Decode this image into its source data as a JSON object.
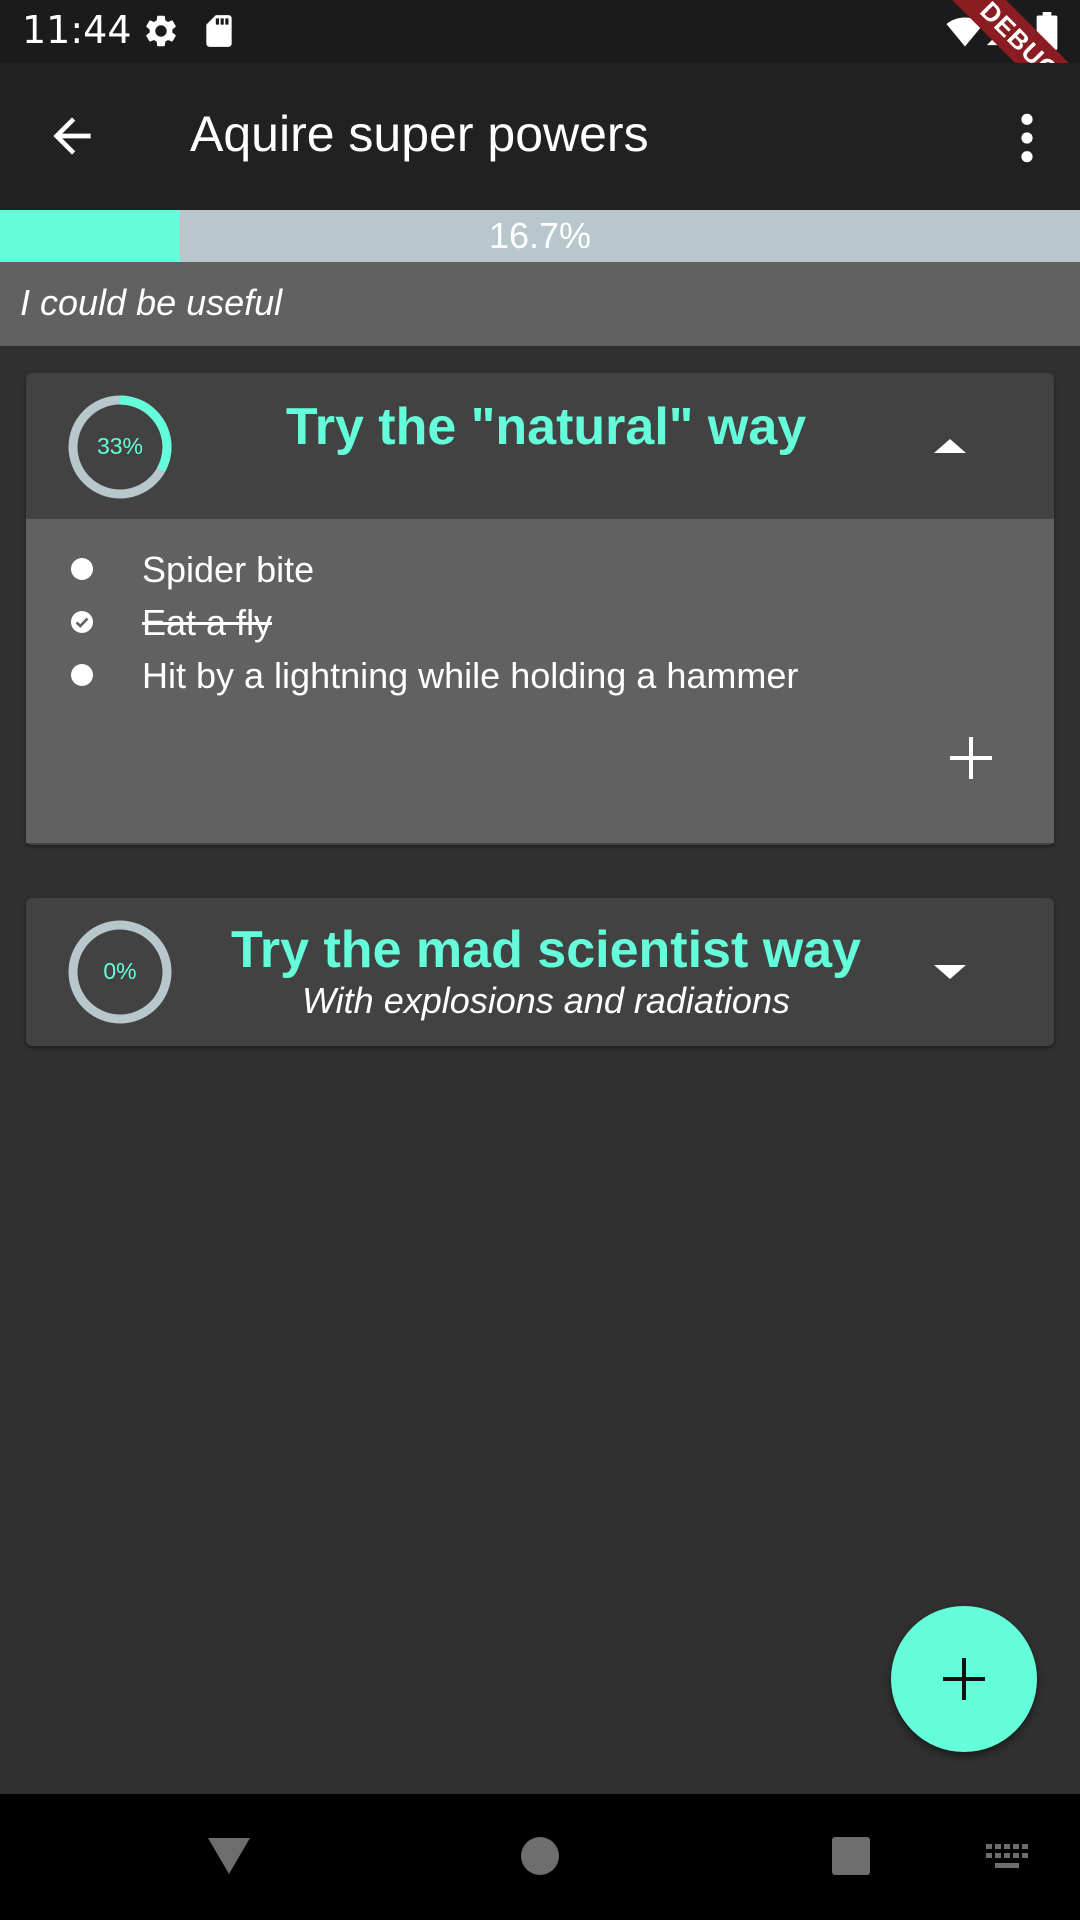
{
  "status_bar": {
    "time": "11:44",
    "icons": [
      "settings-icon",
      "sd-card-icon",
      "wifi-icon",
      "signal-icon",
      "battery-icon"
    ],
    "debug_banner": "DEBUG"
  },
  "app_bar": {
    "title": "Aquire super powers",
    "back_icon": "arrow-back-icon",
    "menu_icon": "more-vert-icon"
  },
  "goal": {
    "progress": 0.167,
    "progress_label": "16.7%",
    "description": "I could be useful"
  },
  "ways": [
    {
      "title": "Try the \"natural\" way",
      "subtitle": "",
      "progress": 0.33,
      "progress_label": "33%",
      "expanded": true,
      "steps": [
        {
          "label": "Spider bite",
          "done": false
        },
        {
          "label": "Eat a fly",
          "done": true
        },
        {
          "label": "Hit by a lightning while holding a hammer",
          "done": false
        }
      ],
      "add_step_icon": "plus-icon"
    },
    {
      "title": "Try the mad scientist way",
      "subtitle": "With explosions and radiations",
      "progress": 0.0,
      "progress_label": "0%",
      "expanded": false
    }
  ],
  "fab_icon": "plus-icon",
  "nav_bar": {
    "icons": [
      "back-triangle-icon",
      "home-circle-icon",
      "recents-square-icon",
      "keyboard-icon"
    ]
  },
  "colors": {
    "accent": "#64ffda",
    "background": "#303030",
    "app_bar": "#212121",
    "card": "#424242",
    "card_body": "#616161",
    "progress_track": "#b8c7cc",
    "debug_ribbon": "#8b1c22"
  }
}
